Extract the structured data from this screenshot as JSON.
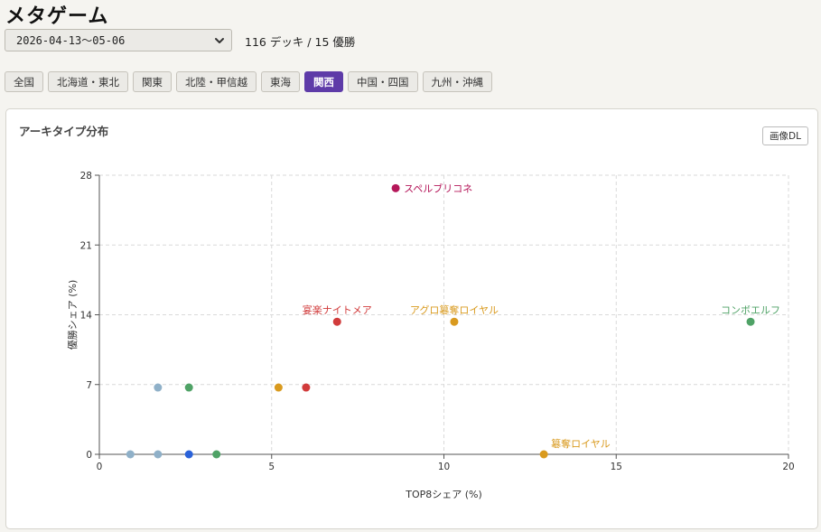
{
  "header": {
    "title": "メタゲーム"
  },
  "filter": {
    "date_range": "2026-04-13～05-06",
    "summary": "116 デッキ / 15 優勝"
  },
  "regions": [
    {
      "label": "全国",
      "active": false
    },
    {
      "label": "北海道・東北",
      "active": false
    },
    {
      "label": "関東",
      "active": false
    },
    {
      "label": "北陸・甲信越",
      "active": false
    },
    {
      "label": "東海",
      "active": false
    },
    {
      "label": "関西",
      "active": true
    },
    {
      "label": "中国・四国",
      "active": false
    },
    {
      "label": "九州・沖縄",
      "active": false
    }
  ],
  "card": {
    "title": "アーキタイプ分布",
    "download_label": "画像DL"
  },
  "chart_data": {
    "type": "scatter",
    "xlabel": "TOP8シェア (%)",
    "ylabel": "優勝シェア (%)",
    "xlim": [
      0,
      20
    ],
    "ylim": [
      0,
      28
    ],
    "xticks": [
      0,
      5,
      10,
      15,
      20
    ],
    "yticks": [
      0,
      7,
      14,
      21,
      28
    ],
    "grid": true,
    "points": [
      {
        "x": 8.6,
        "y": 26.7,
        "label": "スペルブリコネ",
        "color": "#b5175a"
      },
      {
        "x": 6.9,
        "y": 13.3,
        "label": "宴楽ナイトメア",
        "color": "#d13b3b"
      },
      {
        "x": 10.3,
        "y": 13.3,
        "label": "アグロ簒奪ロイヤル",
        "color": "#d99a1e"
      },
      {
        "x": 18.9,
        "y": 13.3,
        "label": "コンボエルフ",
        "color": "#4fa266"
      },
      {
        "x": 12.9,
        "y": 0,
        "label": "簒奪ロイヤル",
        "color": "#d99a1e"
      },
      {
        "x": 1.7,
        "y": 6.7,
        "label": "",
        "color": "#8fb0c8"
      },
      {
        "x": 2.6,
        "y": 6.7,
        "label": "",
        "color": "#4fa266"
      },
      {
        "x": 5.2,
        "y": 6.7,
        "label": "",
        "color": "#d99a1e"
      },
      {
        "x": 6.0,
        "y": 6.7,
        "label": "",
        "color": "#d13b3b"
      },
      {
        "x": 0.9,
        "y": 0,
        "label": "",
        "color": "#8fb0c8"
      },
      {
        "x": 1.7,
        "y": 0,
        "label": "",
        "color": "#8fb0c8"
      },
      {
        "x": 2.6,
        "y": 0,
        "label": "",
        "color": "#2a62d9"
      },
      {
        "x": 3.4,
        "y": 0,
        "label": "",
        "color": "#4fa266"
      }
    ]
  }
}
